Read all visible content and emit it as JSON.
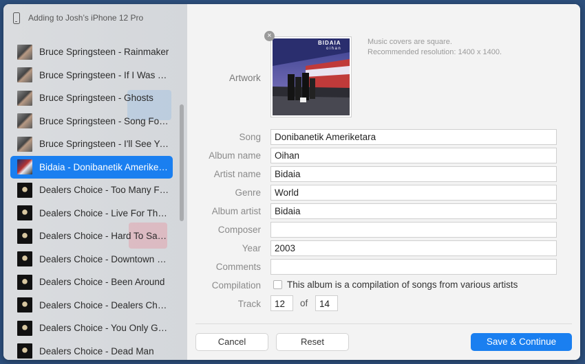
{
  "device": {
    "icon": "phone-icon",
    "label": "Adding to Josh’s iPhone 12 Pro"
  },
  "tracks": [
    {
      "title": "Bruce Springsteen - Rainmaker",
      "thumb": "bruce",
      "selected": false
    },
    {
      "title": "Bruce Springsteen - If I Was The Priest",
      "thumb": "bruce",
      "selected": false
    },
    {
      "title": "Bruce Springsteen - Ghosts",
      "thumb": "bruce",
      "selected": false
    },
    {
      "title": "Bruce Springsteen - Song For Orphans",
      "thumb": "bruce",
      "selected": false
    },
    {
      "title": "Bruce Springsteen - I'll See You In My Dreams",
      "thumb": "bruce",
      "selected": false
    },
    {
      "title": "Bidaia - Donibanetik Ameriketara",
      "thumb": "bidaia",
      "selected": true
    },
    {
      "title": "Dealers Choice - Too Many Fronts",
      "thumb": "dealers",
      "selected": false
    },
    {
      "title": "Dealers Choice - Live For The Moment",
      "thumb": "dealers",
      "selected": false
    },
    {
      "title": "Dealers Choice - Hard To Say Goodbye",
      "thumb": "dealers",
      "selected": false
    },
    {
      "title": "Dealers Choice - Downtown Streets",
      "thumb": "dealers",
      "selected": false
    },
    {
      "title": "Dealers Choice - Been Around",
      "thumb": "dealers",
      "selected": false
    },
    {
      "title": "Dealers Choice - Dealers Choice",
      "thumb": "dealers",
      "selected": false
    },
    {
      "title": "Dealers Choice - You Only Get One",
      "thumb": "dealers",
      "selected": false
    },
    {
      "title": "Dealers Choice - Dead Man",
      "thumb": "dealers",
      "selected": false
    }
  ],
  "artwork": {
    "label": "Artwork",
    "cover_band": "BIDAIA",
    "cover_album": "oihan",
    "remove_symbol": "×",
    "hint_line1": "Music covers are square.",
    "hint_line2": "Recommended resolution: 1400 x 1400."
  },
  "fields": {
    "song": {
      "label": "Song",
      "value": "Donibanetik Ameriketara"
    },
    "album_name": {
      "label": "Album name",
      "value": "Oihan"
    },
    "artist_name": {
      "label": "Artist name",
      "value": "Bidaia"
    },
    "genre": {
      "label": "Genre",
      "value": "World"
    },
    "album_artist": {
      "label": "Album artist",
      "value": "Bidaia"
    },
    "composer": {
      "label": "Composer",
      "value": ""
    },
    "year": {
      "label": "Year",
      "value": "2003"
    },
    "comments": {
      "label": "Comments",
      "value": ""
    }
  },
  "compilation": {
    "label": "Compilation",
    "text": "This album is a compilation of songs from various artists",
    "checked": false
  },
  "track": {
    "label": "Track",
    "number": "12",
    "of_label": "of",
    "total": "14"
  },
  "buttons": {
    "cancel": "Cancel",
    "reset": "Reset",
    "save": "Save & Continue"
  },
  "colors": {
    "accent": "#1a7ff0",
    "desktop": "#2d4f7c"
  }
}
